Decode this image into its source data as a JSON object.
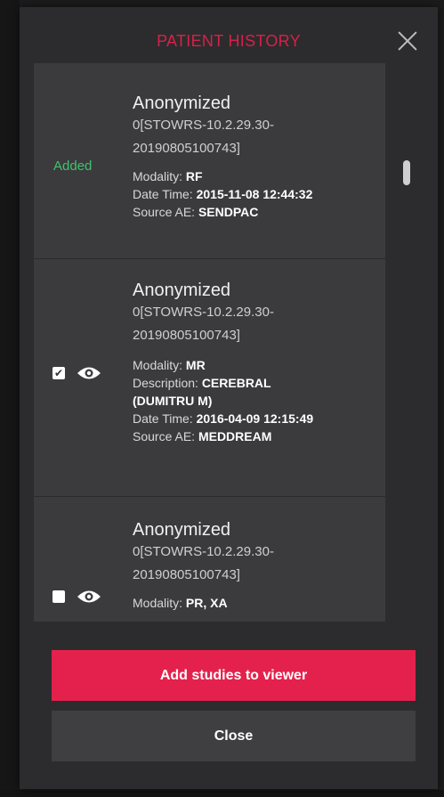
{
  "modal": {
    "title": "PATIENT HISTORY",
    "close_icon": "close-x-icon"
  },
  "studies": [
    {
      "status": "Added",
      "name": "Anonymized",
      "uid_line1": "0[STOWRS-10.2.29.30-",
      "uid_line2": "20190805100743]",
      "modality_label": "Modality:",
      "modality": "RF",
      "datetime_label": "Date Time:",
      "datetime": "2015-11-08 12:44:32",
      "source_label": "Source AE:",
      "source": "SENDPAC"
    },
    {
      "checked": true,
      "check_glyph": "✔",
      "name": "Anonymized",
      "uid_line1": "0[STOWRS-10.2.29.30-",
      "uid_line2": "20190805100743]",
      "modality_label": "Modality:",
      "modality": "MR",
      "description_label": "Description:",
      "description_line1": "CEREBRAL",
      "description_line2": "(DUMITRU M)",
      "datetime_label": "Date Time:",
      "datetime": "2016-04-09 12:15:49",
      "source_label": "Source AE:",
      "source": "MEDDREAM"
    },
    {
      "checked": false,
      "name": "Anonymized",
      "uid_line1": "0[STOWRS-10.2.29.30-",
      "uid_line2": "20190805100743]",
      "modality_label": "Modality:",
      "modality": "PR, XA"
    }
  ],
  "buttons": {
    "add_label": "Add studies to viewer",
    "close_label": "Close"
  },
  "colors": {
    "accent": "#e4214c",
    "title": "#d8204a",
    "added": "#3ec46d"
  }
}
